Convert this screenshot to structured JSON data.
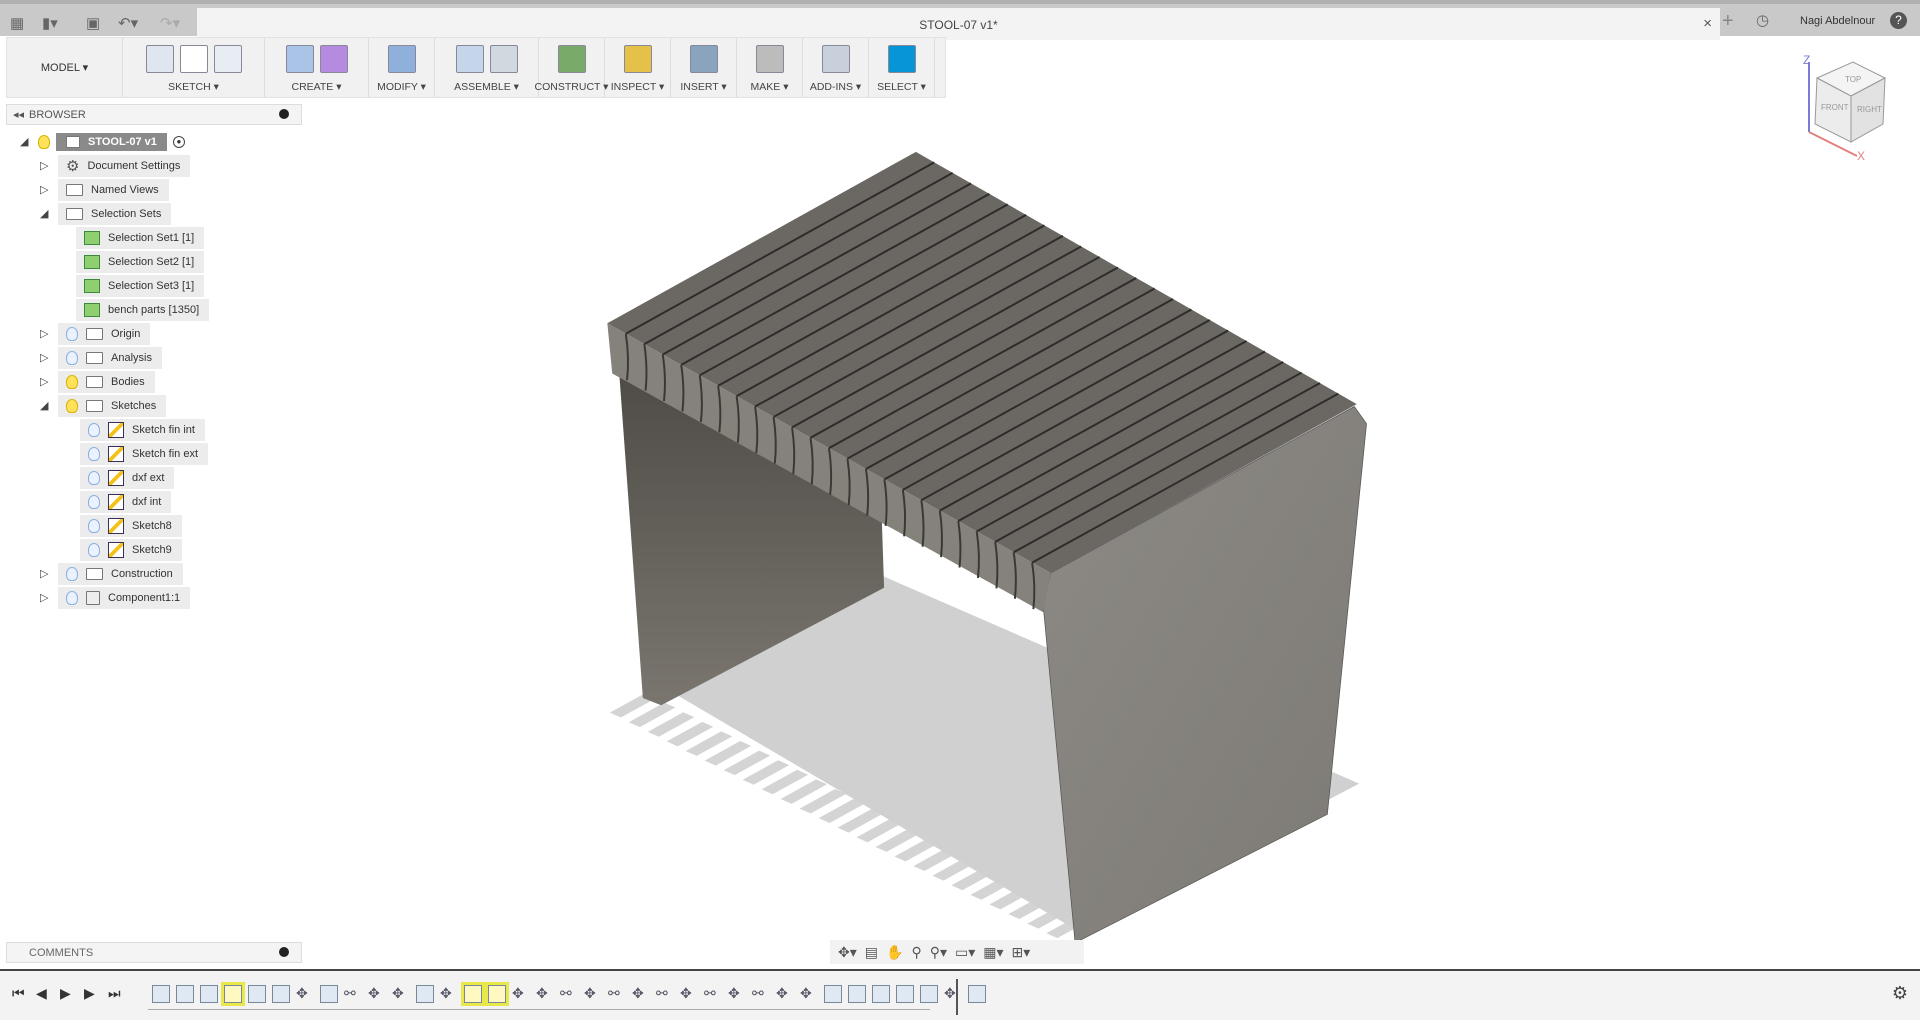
{
  "titlebar": {
    "doc_title": "STOOL-07 v1*",
    "user": "Nagi Abdelnour",
    "close": "×",
    "new_tab": "+",
    "help": "?"
  },
  "toolbar": {
    "workspace": "MODEL ▾",
    "groups": [
      {
        "label": "SKETCH ▾",
        "icons": [
          "create-sketch-icon",
          "arc-icon",
          "rectangle-icon"
        ]
      },
      {
        "label": "CREATE ▾",
        "icons": [
          "extrude-icon",
          "form-icon"
        ]
      },
      {
        "label": "MODIFY ▾",
        "icons": [
          "press-pull-icon"
        ]
      },
      {
        "label": "ASSEMBLE ▾",
        "icons": [
          "new-component-icon",
          "joint-icon"
        ]
      },
      {
        "label": "CONSTRUCT ▾",
        "icons": [
          "offset-plane-icon"
        ]
      },
      {
        "label": "INSPECT ▾",
        "icons": [
          "measure-icon"
        ]
      },
      {
        "label": "INSERT ▾",
        "icons": [
          "insert-image-icon"
        ]
      },
      {
        "label": "MAKE ▾",
        "icons": [
          "3d-print-icon"
        ]
      },
      {
        "label": "ADD-INS ▾",
        "icons": [
          "scripts-addins-icon"
        ]
      },
      {
        "label": "SELECT ▾",
        "icons": [
          "select-icon"
        ]
      }
    ]
  },
  "browser": {
    "title": "BROWSER",
    "root": "STOOL-07 v1",
    "items": [
      {
        "label": "Document Settings",
        "level": 1,
        "icon": "gear",
        "expand": "collapsed"
      },
      {
        "label": "Named Views",
        "level": 1,
        "icon": "folder",
        "expand": "collapsed"
      },
      {
        "label": "Selection Sets",
        "level": 1,
        "icon": "folder",
        "expand": "expanded"
      },
      {
        "label": "Selection Set1 [1]",
        "level": 2,
        "icon": "selset"
      },
      {
        "label": "Selection Set2 [1]",
        "level": 2,
        "icon": "selset"
      },
      {
        "label": "Selection Set3 [1]",
        "level": 2,
        "icon": "selset"
      },
      {
        "label": "bench parts [1350]",
        "level": 2,
        "icon": "selset"
      },
      {
        "label": "Origin",
        "level": 1,
        "icon": "folder",
        "bulb": "off",
        "expand": "collapsed"
      },
      {
        "label": "Analysis",
        "level": 1,
        "icon": "folder",
        "bulb": "off",
        "expand": "collapsed"
      },
      {
        "label": "Bodies",
        "level": 1,
        "icon": "folder",
        "bulb": "on",
        "expand": "collapsed"
      },
      {
        "label": "Sketches",
        "level": 1,
        "icon": "folder",
        "bulb": "on",
        "expand": "expanded"
      },
      {
        "label": "Sketch fin int",
        "level": 2,
        "icon": "sketch",
        "bulb": "off"
      },
      {
        "label": "Sketch fin ext",
        "level": 2,
        "icon": "sketch",
        "bulb": "off"
      },
      {
        "label": "dxf ext",
        "level": 2,
        "icon": "sketch",
        "bulb": "off"
      },
      {
        "label": "dxf int",
        "level": 2,
        "icon": "sketch",
        "bulb": "off"
      },
      {
        "label": "Sketch8",
        "level": 2,
        "icon": "sketch",
        "bulb": "off"
      },
      {
        "label": "Sketch9",
        "level": 2,
        "icon": "sketch",
        "bulb": "off"
      },
      {
        "label": "Construction",
        "level": 1,
        "icon": "folder",
        "bulb": "off",
        "expand": "collapsed"
      },
      {
        "label": "Component1:1",
        "level": 1,
        "icon": "component",
        "bulb": "off",
        "expand": "collapsed"
      }
    ]
  },
  "comments": {
    "title": "COMMENTS"
  },
  "viewcube": {
    "top": "TOP",
    "front": "FRONT",
    "right": "RIGHT",
    "z": "Z",
    "x": "X"
  },
  "colors": {
    "accent": "#0696d7",
    "highlight": "#e8e84a",
    "model": "#87837e"
  },
  "timeline": {
    "icons": [
      "sketch-hl0",
      "extrude",
      "fillet",
      "sketch-hl",
      "extrude",
      "fillet",
      "move",
      "split",
      "joint",
      "move",
      "move",
      "pattern",
      "move",
      "sketch-hl",
      "sketch-hl",
      "move",
      "move",
      "joint",
      "move",
      "joint",
      "move",
      "joint",
      "move",
      "joint",
      "move",
      "joint",
      "move",
      "move",
      "sketch-hl0",
      "box",
      "sketch-hl0",
      "extrude",
      "extrude",
      "move",
      "body"
    ]
  }
}
